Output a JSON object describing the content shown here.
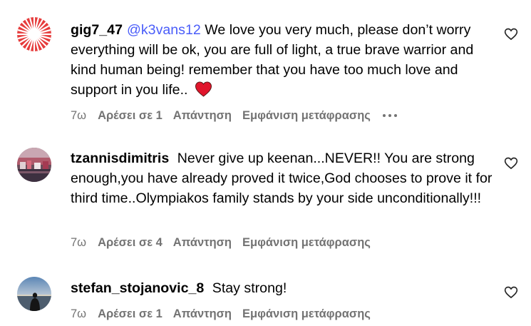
{
  "comments": [
    {
      "username": "gig7_47",
      "mention": "@k3vans12",
      "text": " We love you very much, please don’t worry everything will be ok, you are full of light, a true brave warrior and kind human being! remember that you have too much love and support in you life..",
      "emoji": "red-heart",
      "time": "7ω",
      "likes": "Αρέσει σε 1",
      "reply": "Απάντηση",
      "translate": "Εμφάνιση μετάφρασης"
    },
    {
      "username": "tzannisdimitris",
      "text": " Never give up keenan...NEVER!! You are strong enough,you have already proved it twice,God chooses to prove it for third time..Olympiakos family stands by your side unconditionally!!!",
      "time": "7ω",
      "likes": "Αρέσει σε 4",
      "reply": "Απάντηση",
      "translate": "Εμφάνιση μετάφρασης"
    },
    {
      "username": "stefan_stojanovic_8",
      "text": " Stay strong!",
      "time": "7ω",
      "likes": "Αρέσει σε 1",
      "reply": "Απάντηση",
      "translate": "Εμφάνιση μετάφρασης"
    }
  ],
  "colors": {
    "mention": "#4A5DF9",
    "meta": "#737373",
    "heart": "#E0152B"
  },
  "icons": [
    "heart-outline-icon",
    "more-options-icon",
    "red-heart-emoji"
  ]
}
